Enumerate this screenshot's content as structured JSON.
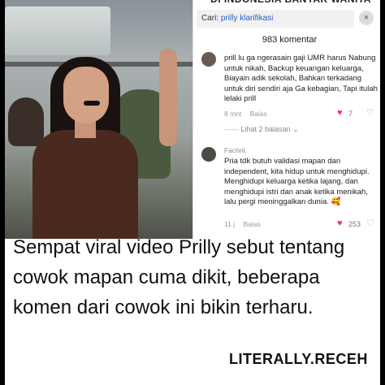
{
  "banner": "DI INDONESIA BANYAK WANITA",
  "search": {
    "prefix": "Cari:",
    "query": "prilly klarifikasi"
  },
  "close_glyph": "×",
  "comment_count": "983 komentar",
  "comments": [
    {
      "username": "",
      "text": "prill lu ga ngerasain gaji UMR harus Nabung untuk nikah, Backup keuangan keluarga, Biayain adik sekolah, Bahkan terkadang untuk diri sendiri aja Ga kebagian, Tapi itulah lelaki prill",
      "time": "8 mnt",
      "reply_label": "Balas",
      "likes": "7",
      "replies_label": "Lihat 2 balasan"
    },
    {
      "username": "Fachrii.",
      "text": "Pria tdk butuh validasi mapan dan independent, kita hidup untuk menghidupi. Menghidupi keluarga ketika lajang, dan menghidupi istri dan anak ketika menikah, lalu pergi meninggalkan dunia. 🥰",
      "time": "11 j",
      "reply_label": "Balas",
      "likes": "253"
    }
  ],
  "caption": "Sempat viral video Prilly sebut tentang cowok mapan cuma dikit, beberapa komen dari cowok ini bikin terharu.",
  "brand": "LITERALLY.RECEH",
  "icons": {
    "like": "heart-icon",
    "dislike": "dislike-icon",
    "chevron": "chevron-down-icon"
  },
  "colors": {
    "heart": "#fe2c55",
    "link": "#1f5fbf"
  }
}
